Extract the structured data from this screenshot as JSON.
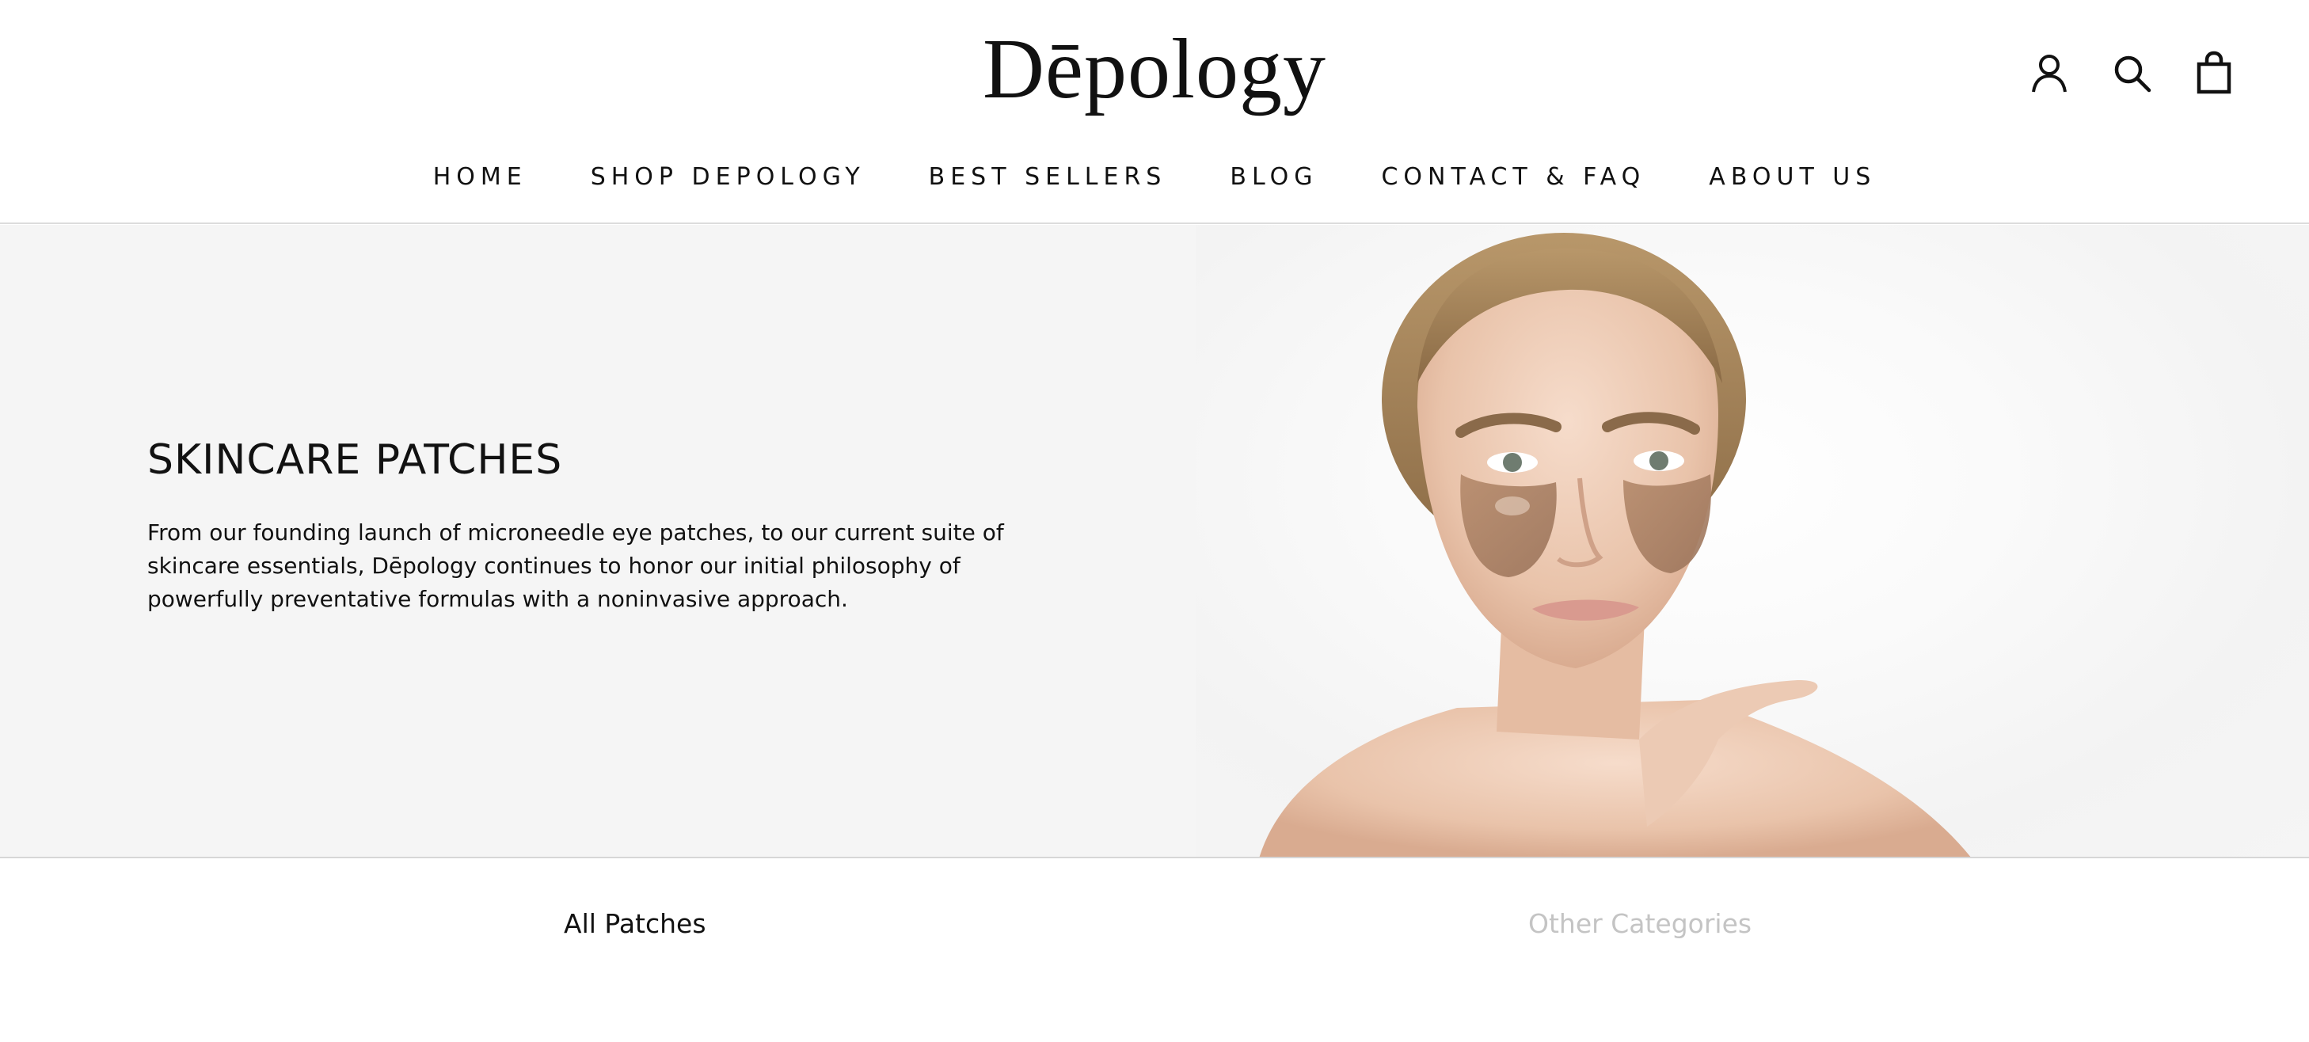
{
  "brand": {
    "logo_text": "Dēpology"
  },
  "header_icons": [
    {
      "name": "account-icon"
    },
    {
      "name": "search-icon"
    },
    {
      "name": "shopping-bag-icon"
    }
  ],
  "nav": {
    "items": [
      {
        "label": "HOME"
      },
      {
        "label": "SHOP DEPOLOGY"
      },
      {
        "label": "BEST SELLERS"
      },
      {
        "label": "BLOG"
      },
      {
        "label": "CONTACT & FAQ"
      },
      {
        "label": "ABOUT US"
      }
    ]
  },
  "hero": {
    "title": "SKINCARE PATCHES",
    "description": "From our founding launch of microneedle eye patches, to our current suite of skincare essentials, Dēpology continues to honor our initial philosophy of powerfully preventative formulas with a noninvasive approach.",
    "background_color": "#f5f5f5"
  },
  "tabs": {
    "all_label": "All Patches",
    "other_label": "Other Categories",
    "active_color": "#111111",
    "inactive_color": "#c4c4c4"
  }
}
